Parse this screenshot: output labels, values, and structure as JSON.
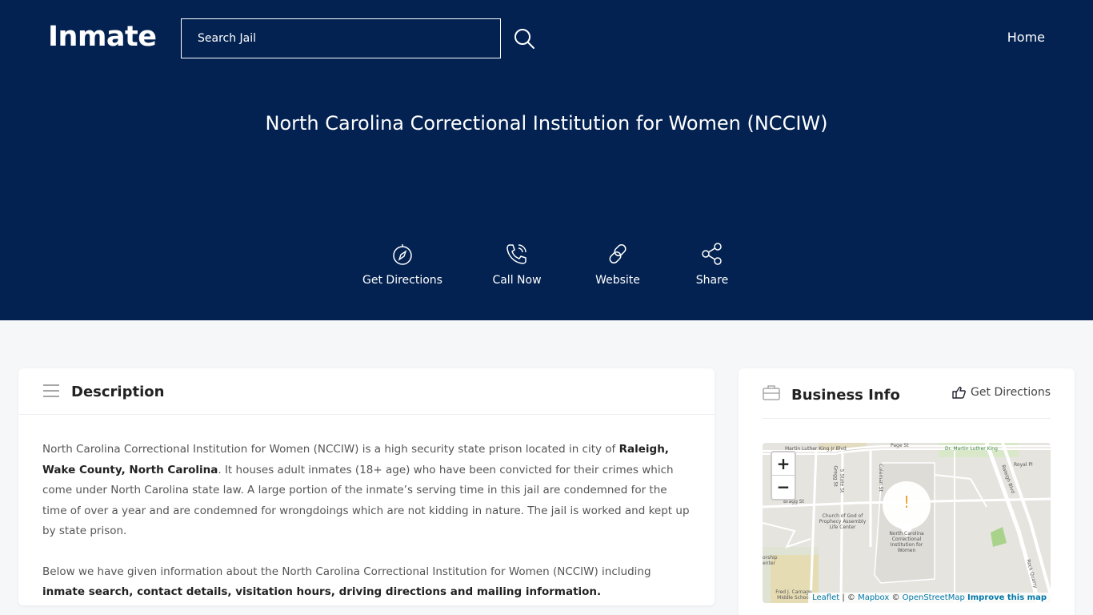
{
  "header": {
    "logo": "Inmate",
    "search_placeholder": "Search Jail",
    "nav_home": "Home"
  },
  "hero": {
    "title": "North Carolina Correctional Institution for Women (NCCIW)",
    "actions": [
      {
        "label": "Get Directions",
        "icon": "compass-icon"
      },
      {
        "label": "Call Now",
        "icon": "phone-icon"
      },
      {
        "label": "Website",
        "icon": "link-icon"
      },
      {
        "label": "Share",
        "icon": "share-icon"
      }
    ]
  },
  "description": {
    "title": "Description",
    "p1_a": "North Carolina Correctional Institution for Women (NCCIW) is a high security state prison located in city of ",
    "p1_bold": "Raleigh, Wake County, North Carolina",
    "p1_b": ". It houses adult inmates (18+ age) who have been convicted for their crimes which come under North Carolina state law. A large portion of the inmate’s serving time in this jail are condemned for the time of over a year and are condemned for wrongdoings which are not kidding in nature. The jail is worked and kept up by state prison.",
    "p2_a": "Below we have given information about the North Carolina Correctional Institution for Women (NCCIW) including ",
    "p2_bold": "inmate search, contact details, visitation hours, driving directions and mailing information."
  },
  "business": {
    "title": "Business Info",
    "directions": "Get Directions",
    "map": {
      "zoom_in": "+",
      "zoom_out": "−",
      "marker": "!",
      "attr_leaflet": "Leaflet",
      "attr_sep1": " | © ",
      "attr_mapbox": "Mapbox",
      "attr_sep2": " © ",
      "attr_osm": "OpenStreetMap",
      "attr_improve": "Improve this map",
      "labels": {
        "mlk": "Martin Luther King Jr Blvd",
        "page": "Page St",
        "dr_mlk": "Dr. Martin Luther King",
        "gregg": "Gregg St",
        "s_state": "S State St",
        "coleman": "Coleman St",
        "bragg": "Bragg St",
        "church": "Church of God of Prophecy Assembly Life Center",
        "ncciw": "North Carolina Correctional Institution for Women",
        "raleigh": "Raleigh Blvd",
        "royal": "Royal Pl",
        "rock": "Rock Quarry",
        "carnage": "Fred J. Carnage Middle School",
        "worship": "orship enter"
      }
    }
  }
}
